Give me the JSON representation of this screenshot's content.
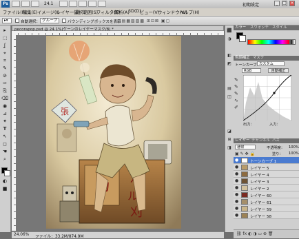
{
  "appbar": {
    "logo": "Ps",
    "zoom": "24.1",
    "workspace": "初期設定",
    "window_buttons": [
      "_",
      "□",
      "×"
    ]
  },
  "menubar": {
    "items": [
      "ファイル(F)",
      "編集(E)",
      "イメージ(I)",
      "レイヤー(L)",
      "選択範囲(S)",
      "フィルタ(T)",
      "解析(A)",
      "3D(D)",
      "ビュー(V)",
      "ウィンドウ(W)",
      "ヘルプ(H)"
    ]
  },
  "options": {
    "auto_select_label": "自動選択：",
    "auto_select_value": "グループ",
    "transform_label": "バウンディングボックスを表示"
  },
  "tools": [
    "▸",
    "⬚",
    "ʆ",
    "⌖",
    "⌗",
    "✎",
    "⊘",
    "✑",
    "⎘",
    "⌫",
    "◉",
    "⊿",
    "✦",
    "T",
    "↖",
    "◻",
    "☚",
    "⌕",
    "◐",
    "■"
  ],
  "document": {
    "tab_title": "pecorapop.psd @ 24.1%(ケーンのレイヤーマスク/8) *",
    "status_zoom": "24.06%",
    "status_file": "ファイル：33.2M/874.9M"
  },
  "side_icons": [
    "⬛",
    "◑",
    "◧",
    "◩",
    "▤",
    "◫",
    "◪",
    "⊞",
    "◨"
  ],
  "panels": {
    "color_tabs": [
      "カラー",
      "スウォッチ",
      "スタイル"
    ],
    "adjust_tabs": [
      "色調補正",
      "マスク"
    ],
    "adjust_title": "トーンカーブ",
    "adjust_preset": "カスタム",
    "channel": "RGB",
    "auto_button": "自動補正",
    "input_label": "入力：",
    "output_label": "出力：",
    "layers_tabs": [
      "レイヤー",
      "チャンネル",
      "パス"
    ],
    "blend_mode": "通常",
    "opacity_label": "不透明度：",
    "opacity_value": "100%",
    "fill_label": "塗り：",
    "fill_value": "100%",
    "layers": [
      "トーンカーブ 1",
      "レイヤー 5",
      "レイヤー 4",
      "レイヤー 3",
      "レイヤー 2",
      "レイヤー 60",
      "レイヤー 61",
      "レイヤー 59",
      "レイヤー 58"
    ]
  },
  "artwork": {
    "sign_left": "張",
    "sign_right_1": "八",
    "sign_right_2": "ル",
    "sign_right_3": "刈",
    "box_char": "カ"
  }
}
